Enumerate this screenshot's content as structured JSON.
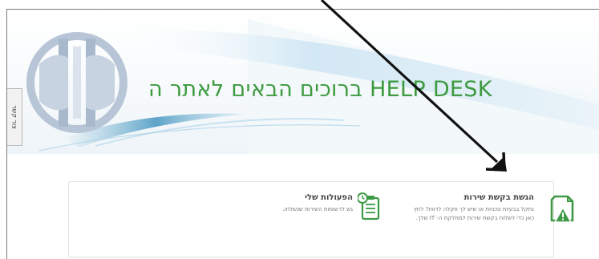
{
  "header": {
    "title": "ברוכים הבאים לאתר ה HELP DESK"
  },
  "side_tab": {
    "label": "צור קשר"
  },
  "cards": [
    {
      "title": "הגשת בקשת שירות",
      "desc": "נתקל בבעיות טכניות או שיש לך תקלה לדווח? לחץ כאן כדי לשלוח בקשת שירות למחלקת ה- IT שלך.",
      "icon": "warning-document-icon"
    },
    {
      "title": "הפעולות שלי",
      "desc": "גש לרשומות השירות שנשלחו.",
      "icon": "clipboard-clock-icon"
    }
  ],
  "colors": {
    "title_green": "#3d9a3f",
    "icon_green": "#3e9a45",
    "logo_blue": "#9fb2c8"
  }
}
